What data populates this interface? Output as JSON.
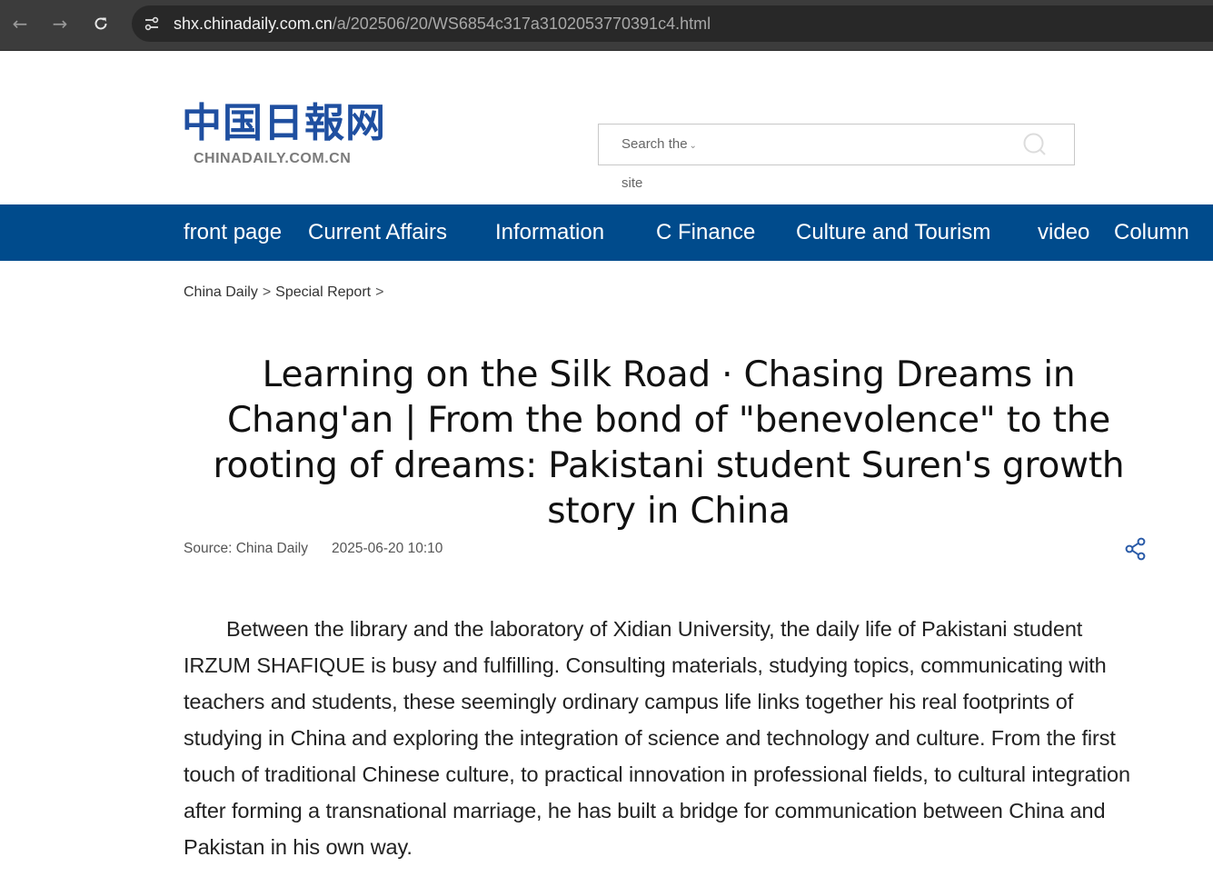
{
  "browser": {
    "url_host": "shx.chinadaily.com.cn",
    "url_path": "/a/202506/20/WS6854c317a3102053770391c4.html"
  },
  "header": {
    "logo_cn": "中国日報网",
    "logo_en": "CHINADAILY.COM.CN",
    "search_scope": "Search the",
    "search_scope_extra": "site"
  },
  "nav": {
    "items": [
      {
        "label": "front page"
      },
      {
        "label": "Current Affairs"
      },
      {
        "label": "Information"
      },
      {
        "label": "C Finance"
      },
      {
        "label": "Culture and Tourism"
      },
      {
        "label": "video"
      },
      {
        "label": "Column"
      }
    ]
  },
  "breadcrumb": {
    "items": [
      "China Daily",
      "Special Report"
    ],
    "separator": ">"
  },
  "article": {
    "title": "Learning on the Silk Road · Chasing Dreams in Chang'an | From the bond of \"benevolence\" to the rooting of dreams: Pakistani student Suren's growth story in China",
    "source": "Source: China Daily",
    "date": "2025-06-20 10:10",
    "body": "Between the library and the laboratory of Xidian University, the daily life of Pakistani student IRZUM SHAFIQUE is busy and fulfilling. Consulting materials, studying topics, communicating with teachers and students, these seemingly ordinary campus life links together his real footprints of studying in China and exploring the integration of science and technology and culture. From the first touch of traditional Chinese culture, to practical innovation in professional fields, to cultural integration after forming a transnational marriage, he has built a bridge for communication between China and Pakistan in his own way."
  },
  "colors": {
    "nav_bg": "#004b8c",
    "logo_blue": "#1f4fa0",
    "share_icon": "#2a5ba8"
  },
  "icons": {
    "back": "arrow-left-icon",
    "forward": "arrow-right-icon",
    "reload": "reload-icon",
    "site_info": "tune-icon",
    "search": "search-icon",
    "share": "share-icon"
  }
}
